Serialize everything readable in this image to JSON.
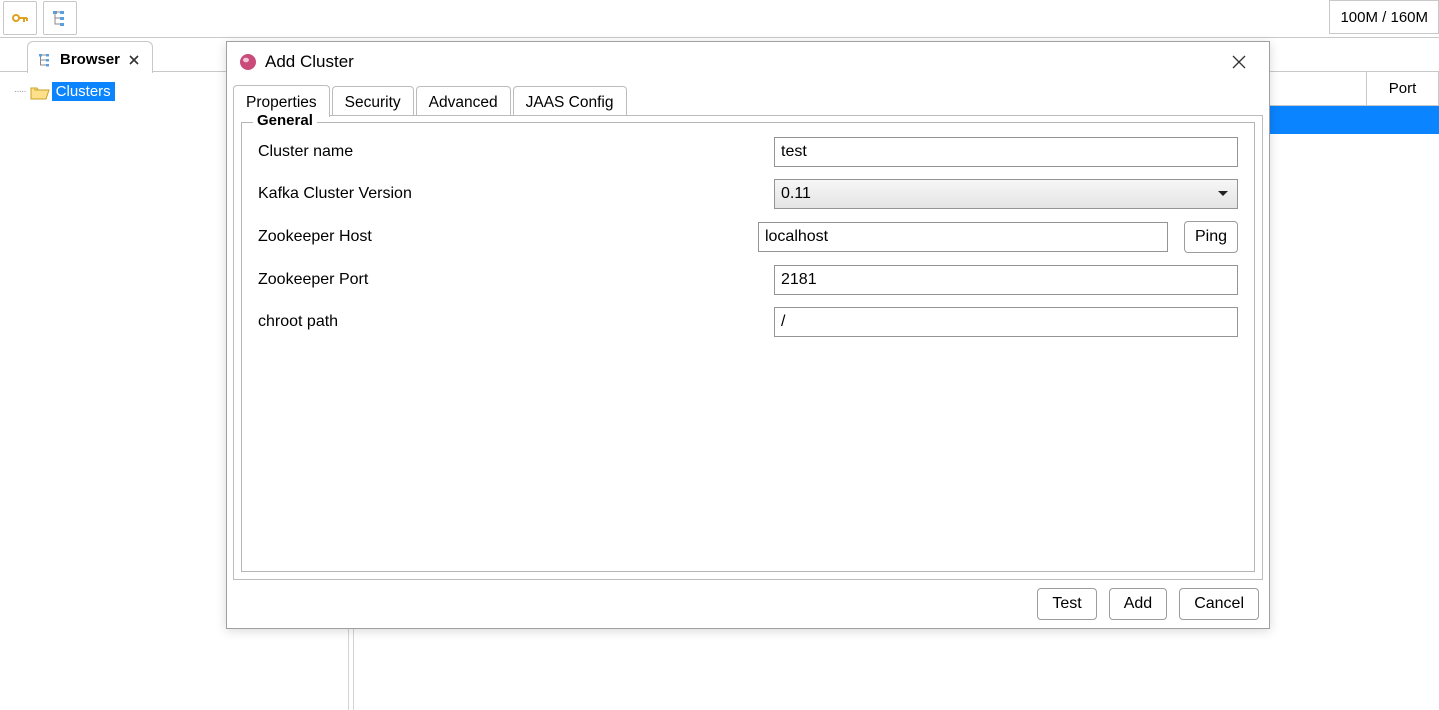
{
  "toolbar": {
    "memory": "100M / 160M"
  },
  "browser_tab": {
    "label": "Browser"
  },
  "tree": {
    "root_label": "Clusters"
  },
  "list": {
    "col_port": "Port"
  },
  "dialog": {
    "title": "Add Cluster",
    "tabs": {
      "properties": "Properties",
      "security": "Security",
      "advanced": "Advanced",
      "jaas": "JAAS Config"
    },
    "legend": "General",
    "labels": {
      "cluster_name": "Cluster name",
      "version": "Kafka Cluster Version",
      "zk_host": "Zookeeper Host",
      "zk_port": "Zookeeper Port",
      "chroot": "chroot path"
    },
    "values": {
      "cluster_name": "test",
      "version": "0.11",
      "zk_host": "localhost",
      "zk_port": "2181",
      "chroot": "/"
    },
    "buttons": {
      "ping": "Ping",
      "test": "Test",
      "add": "Add",
      "cancel": "Cancel"
    }
  }
}
